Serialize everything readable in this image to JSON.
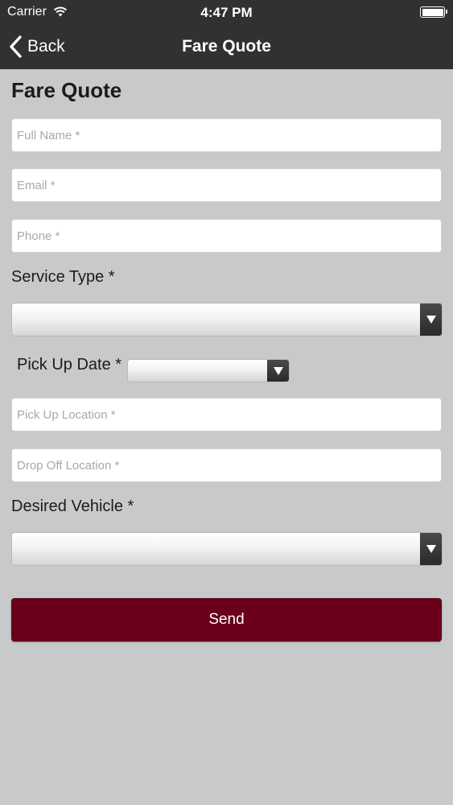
{
  "status": {
    "carrier": "Carrier",
    "time": "4:47 PM"
  },
  "nav": {
    "back_label": "Back",
    "title": "Fare Quote"
  },
  "form": {
    "heading": "Fare Quote",
    "full_name_placeholder": "Full Name *",
    "email_placeholder": "Email *",
    "phone_placeholder": "Phone *",
    "service_type_label": "Service Type *",
    "pickup_date_label": "Pick Up Date *",
    "pickup_location_placeholder": "Pick Up Location *",
    "dropoff_location_placeholder": "Drop Off Location *",
    "desired_vehicle_label": "Desired Vehicle *",
    "send_label": "Send"
  },
  "colors": {
    "nav_background": "#323030",
    "page_background": "#c8c9cb",
    "send_button": "#6a0019"
  }
}
